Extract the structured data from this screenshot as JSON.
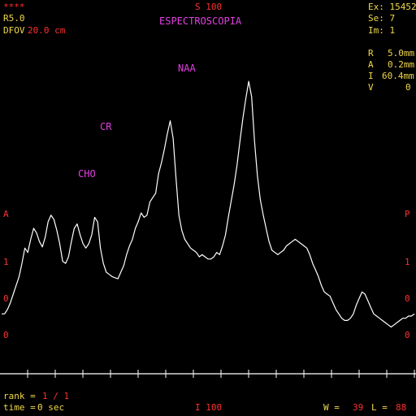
{
  "header": {
    "stars": "****",
    "series_code": "R5.0",
    "dfov_label": "DFOV",
    "dfov_value": "20.0 cm",
    "orientation_top": "S 100",
    "title": "ESPECTROSCOPIA"
  },
  "exam_info": {
    "ex": "Ex: 15452",
    "se": "Se: 7",
    "im": "Im: 1",
    "r_label": "R",
    "r_value": "5.0mm",
    "a_label": "A",
    "a_value": "0.2mm",
    "i_label": "I",
    "i_value": "60.4mm",
    "v_label": "V",
    "v_value": "0"
  },
  "side_labels": {
    "left": [
      "A",
      "1",
      "0",
      "0"
    ],
    "right": [
      "P",
      "1",
      "0",
      "0"
    ]
  },
  "peaks": {
    "naa": "NAA",
    "cr": "CR",
    "cho": "CHO"
  },
  "footer": {
    "rank_label": "rank =",
    "rank_value": "1 / 1",
    "time_label": "time =",
    "time_value": "0 sec",
    "orientation_bottom": "I 100",
    "w_label": "W =",
    "w_value": "39",
    "l_label": "L =",
    "l_value": "88"
  },
  "colors": {
    "background": "#000000",
    "trace": "#ffffff",
    "overlay_text": "#f0d84a",
    "accent_red": "#ff3030",
    "peak_label": "#e040e0"
  },
  "chart_data": {
    "type": "line",
    "title": "ESPECTROSCOPIA",
    "grid": false,
    "annotations": [
      "NAA",
      "CR",
      "CHO"
    ],
    "series": [
      {
        "values": [
          62,
          62,
          66,
          72,
          80,
          88,
          96,
          108,
          122,
          118,
          130,
          140,
          136,
          128,
          123,
          132,
          146,
          152,
          148,
          138,
          126,
          110,
          108,
          114,
          128,
          140,
          144,
          134,
          126,
          122,
          126,
          134,
          150,
          146,
          122,
          108,
          100,
          98,
          96,
          95,
          94,
          100,
          106,
          116,
          124,
          130,
          140,
          146,
          154,
          150,
          152,
          164,
          168,
          172,
          190,
          200,
          212,
          226,
          238,
          222,
          186,
          152,
          138,
          130,
          126,
          122,
          120,
          118,
          114,
          116,
          114,
          112,
          112,
          114,
          118,
          116,
          124,
          134,
          150,
          165,
          180,
          198,
          220,
          240,
          258,
          274,
          260,
          220,
          188,
          166,
          152,
          140,
          128,
          120,
          118,
          116,
          118,
          120,
          124,
          126,
          128,
          130,
          128,
          126,
          124,
          122,
          116,
          108,
          102,
          96,
          88,
          82,
          80,
          78,
          72,
          66,
          62,
          58,
          56,
          56,
          58,
          62,
          70,
          76,
          82,
          80,
          74,
          68,
          62,
          60,
          58,
          56,
          54,
          52,
          50,
          52,
          54,
          56,
          58,
          58,
          60,
          60,
          62
        ]
      }
    ]
  }
}
